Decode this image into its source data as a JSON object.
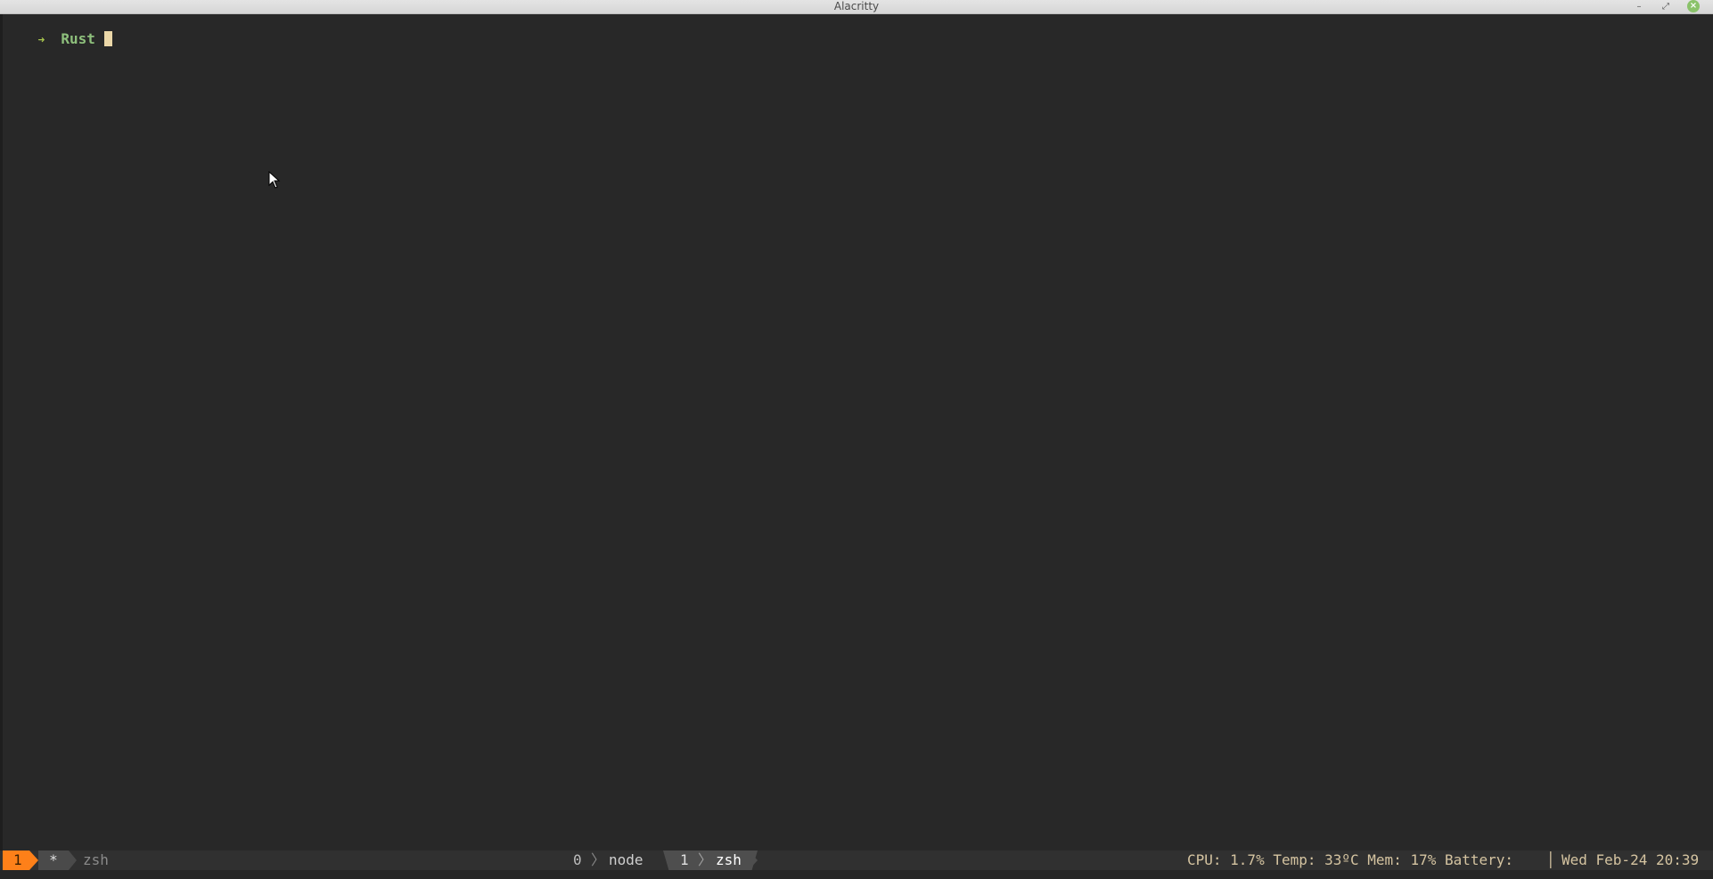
{
  "window": {
    "title": "Alacritty",
    "minimize_glyph": "–",
    "maximize_glyph": "⤢",
    "close_glyph": "×"
  },
  "terminal": {
    "prompt_arrow": "➜",
    "cwd": "Rust",
    "input": ""
  },
  "tmux": {
    "session_index": "1",
    "flag": "*",
    "current_program": "zsh",
    "windows": [
      {
        "index": "0",
        "separator": "〉",
        "name": "node",
        "active": false
      },
      {
        "index": "1",
        "separator": "〉",
        "name": "zsh",
        "active": true
      }
    ],
    "status_right": "CPU: 1.7% Temp: 33ºC Mem: 17% Battery:",
    "status_separator": "│",
    "datetime": "Wed Feb-24 20:39"
  },
  "colors": {
    "terminal_bg": "#282828",
    "session_badge": "#fe8019",
    "prompt_green": "#8ec07c",
    "cursor": "#ebd7a8",
    "status_text": "#d5c4a1"
  }
}
